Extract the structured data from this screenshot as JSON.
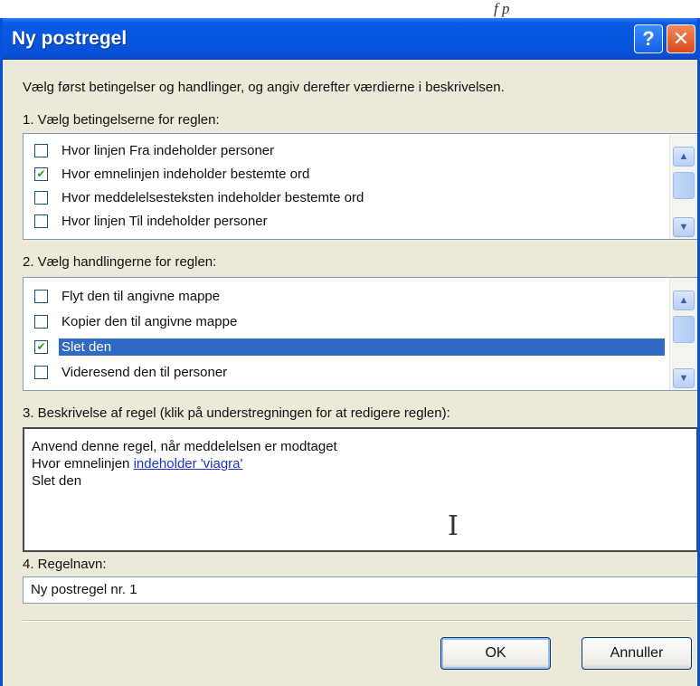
{
  "background_text": "f                              p",
  "window": {
    "title": "Ny postregel",
    "help_glyph": "?",
    "close_glyph": "✕"
  },
  "intro_text": "Vælg først betingelser og handlinger, og angiv derefter værdierne i beskrivelsen.",
  "conditions": {
    "label": "1. Vælg betingelserne for reglen:",
    "items": [
      {
        "label": "Hvor linjen Fra indeholder personer",
        "checked": false
      },
      {
        "label": "Hvor emnelinjen indeholder bestemte ord",
        "checked": true
      },
      {
        "label": "Hvor meddelelsesteksten indeholder bestemte ord",
        "checked": false
      },
      {
        "label": "Hvor linjen Til indeholder personer",
        "checked": false
      }
    ]
  },
  "actions": {
    "label": "2. Vælg handlingerne for reglen:",
    "items": [
      {
        "label": "Flyt den til angivne mappe",
        "checked": false,
        "selected": false
      },
      {
        "label": "Kopier den til angivne mappe",
        "checked": false,
        "selected": false
      },
      {
        "label": "Slet den",
        "checked": true,
        "selected": true
      },
      {
        "label": "Videresend den til personer",
        "checked": false,
        "selected": false
      }
    ]
  },
  "description": {
    "label": "3. Beskrivelse af regel (klik på understregningen for at redigere reglen):",
    "line1": "Anvend denne regel, når meddelelsen er modtaget",
    "line2_prefix": "Hvor emnelinjen ",
    "line2_link": "indeholder 'viagra'",
    "line3": "Slet den"
  },
  "rule_name": {
    "label": "4. Regelnavn:",
    "value": "Ny postregel nr. 1"
  },
  "buttons": {
    "ok": "OK",
    "cancel": "Annuller"
  },
  "colors": {
    "titlebar": "#0657e0",
    "selection": "#316ac5",
    "dialog_bg": "#ece9d8"
  }
}
